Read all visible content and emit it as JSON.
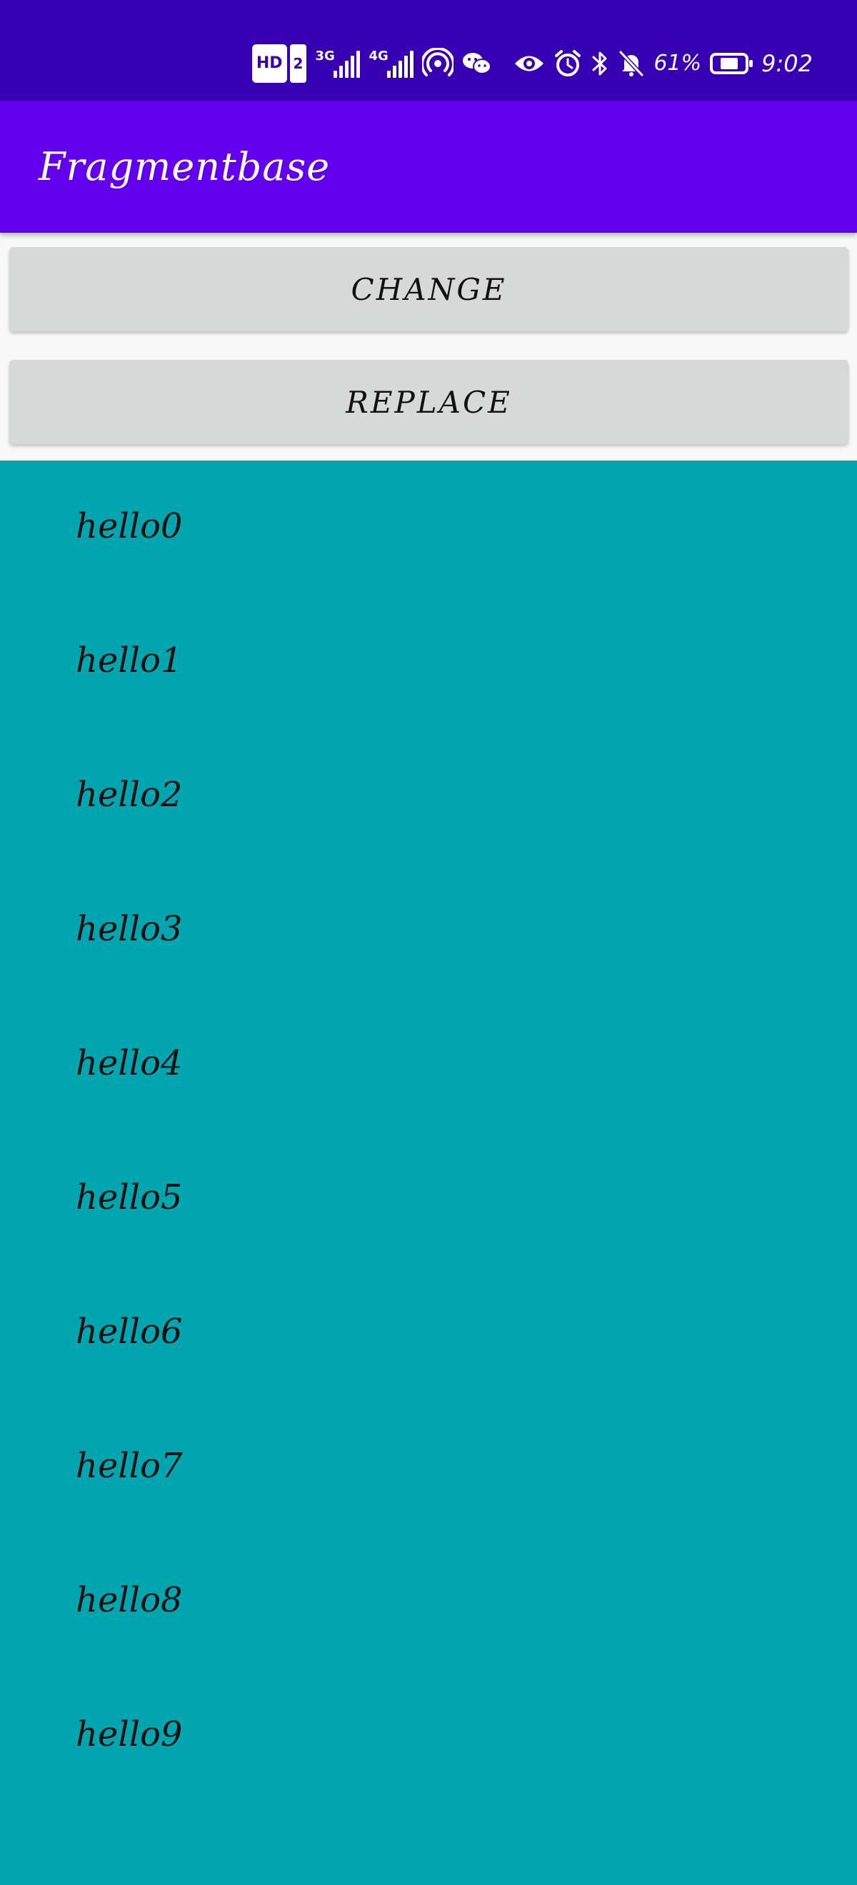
{
  "status_bar": {
    "hd_label": "HD",
    "sim_label": "2",
    "network_1": "3G",
    "network_2": "4G",
    "battery_percent": "61%",
    "battery_level": 0.61,
    "time": "9:02",
    "icons": [
      "hd-icon",
      "signal-3g-icon",
      "signal-4g-icon",
      "hotspot-icon",
      "wechat-icon",
      "eye-icon",
      "alarm-icon",
      "bluetooth-icon",
      "mute-icon",
      "battery-icon"
    ]
  },
  "app_bar": {
    "title": "Fragmentbase"
  },
  "buttons": {
    "change_label": "CHANGE",
    "replace_label": "REPLACE"
  },
  "list": {
    "items": [
      "hello0",
      "hello1",
      "hello2",
      "hello3",
      "hello4",
      "hello5",
      "hello6",
      "hello7",
      "hello8",
      "hello9"
    ]
  },
  "colors": {
    "status_bar": "#3700b3",
    "app_bar": "#6200ee",
    "button_bg": "#d7d8d8",
    "fragment_bg": "#00a5b0"
  }
}
